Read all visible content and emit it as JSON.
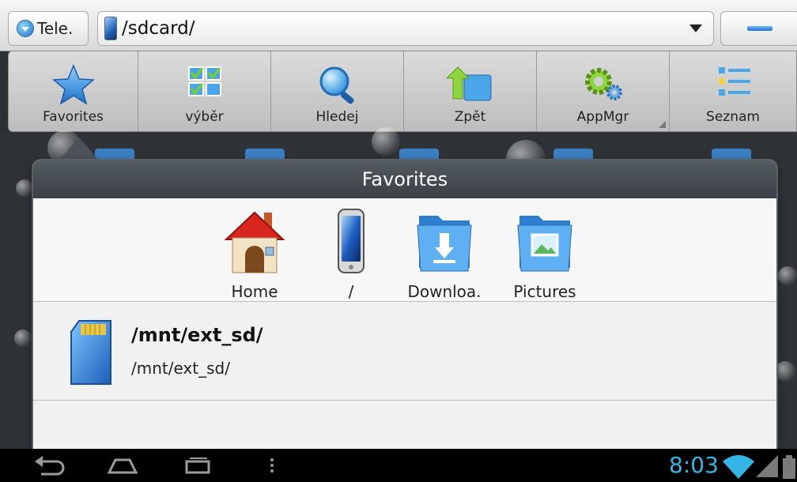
{
  "address_bar": {
    "tele_label": "Tele.",
    "path": "/sdcard/"
  },
  "toolbar": {
    "items": [
      {
        "label": "Favorites",
        "icon": "star-icon"
      },
      {
        "label": "výběr",
        "icon": "multi-select-icon"
      },
      {
        "label": "Hledej",
        "icon": "search-icon"
      },
      {
        "label": "Zpět",
        "icon": "back-folder-icon"
      },
      {
        "label": "AppMgr",
        "icon": "gears-icon"
      },
      {
        "label": "Seznam",
        "icon": "list-view-icon"
      }
    ]
  },
  "popup": {
    "title": "Favorites",
    "favorites": [
      {
        "label": "Home",
        "icon": "home-icon"
      },
      {
        "label": "/",
        "icon": "phone-icon"
      },
      {
        "label": "Downloa.",
        "icon": "download-folder-icon"
      },
      {
        "label": "Pictures",
        "icon": "pictures-folder-icon"
      }
    ],
    "entries": [
      {
        "title": "/mnt/ext_sd/",
        "path": "/mnt/ext_sd/",
        "icon": "sd-card-icon"
      }
    ]
  },
  "status": {
    "clock": "8:03"
  },
  "colors": {
    "accent": "#33b5e5",
    "popup_header": "#464c52",
    "toolbar": "#cfcfcf"
  }
}
